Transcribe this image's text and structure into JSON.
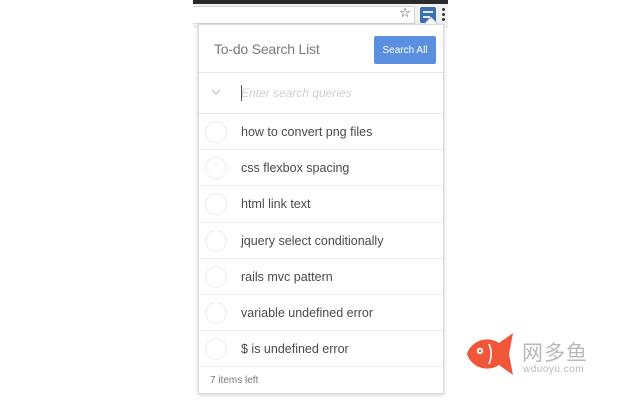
{
  "browser": {
    "icons": [
      "star-icon",
      "extension-icon",
      "more-icon"
    ]
  },
  "popup": {
    "title": "To-do Search List",
    "search_all_label": "Search All",
    "input": {
      "value": "",
      "placeholder": "Enter search queries"
    },
    "items": [
      {
        "label": "how to convert png files",
        "done": false
      },
      {
        "label": "css flexbox spacing",
        "done": false
      },
      {
        "label": "html link text",
        "done": false
      },
      {
        "label": "jquery select conditionally",
        "done": false
      },
      {
        "label": "rails mvc pattern",
        "done": false
      },
      {
        "label": "variable undefined error",
        "done": false
      },
      {
        "label": "$ is undefined error",
        "done": false
      }
    ],
    "footer": {
      "items_left": "7 items left"
    }
  },
  "watermark": {
    "name": "网多鱼",
    "url": "wduoyu.com"
  },
  "colors": {
    "accent": "#5b8fe0",
    "logo": "#f0563a"
  }
}
